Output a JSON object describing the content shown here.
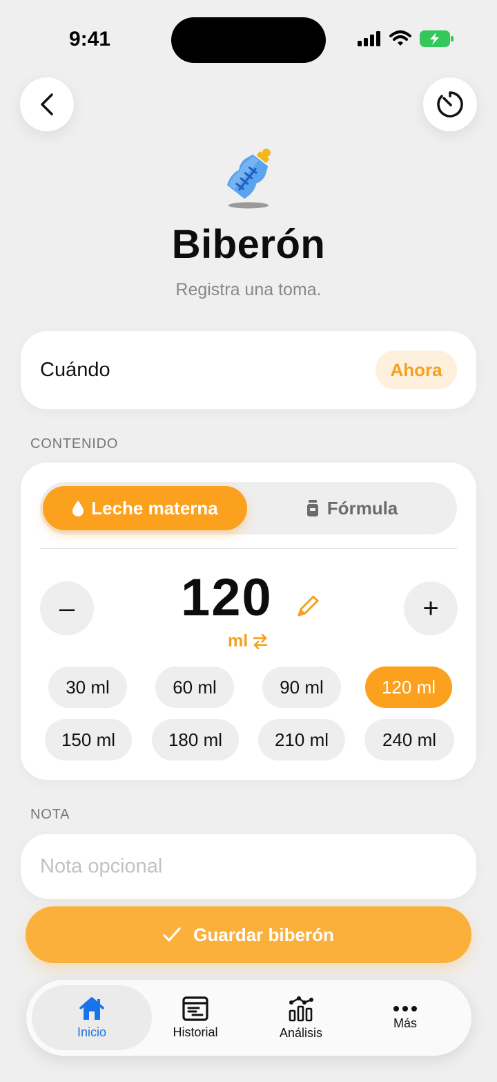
{
  "status_bar": {
    "time": "9:41"
  },
  "header": {
    "title": "Biberón",
    "subtitle": "Registra una toma."
  },
  "when": {
    "label": "Cuándo",
    "value": "Ahora"
  },
  "content": {
    "section_label": "CONTENIDO",
    "types": [
      {
        "label": "Leche materna",
        "icon": "drop-icon",
        "selected": true
      },
      {
        "label": "Fórmula",
        "icon": "formula-can-icon",
        "selected": false
      }
    ],
    "amount": "120",
    "unit": "ml",
    "minus_symbol": "–",
    "plus_symbol": "+",
    "presets": [
      "30 ml",
      "60 ml",
      "90 ml",
      "120 ml",
      "150 ml",
      "180 ml",
      "210 ml",
      "240 ml"
    ],
    "selected_preset": "120 ml"
  },
  "note": {
    "section_label": "NOTA",
    "placeholder": "Nota opcional"
  },
  "save_button": {
    "label": "Guardar biberón"
  },
  "tabbar": {
    "items": [
      {
        "label": "Inicio",
        "icon": "home-icon",
        "active": true
      },
      {
        "label": "Historial",
        "icon": "history-icon",
        "active": false
      },
      {
        "label": "Análisis",
        "icon": "analytics-icon",
        "active": false
      },
      {
        "label": "Más",
        "icon": "more-icon",
        "active": false
      }
    ]
  },
  "colors": {
    "accent": "#fba11d",
    "tab_active": "#1a73e8",
    "background": "#efefef"
  }
}
